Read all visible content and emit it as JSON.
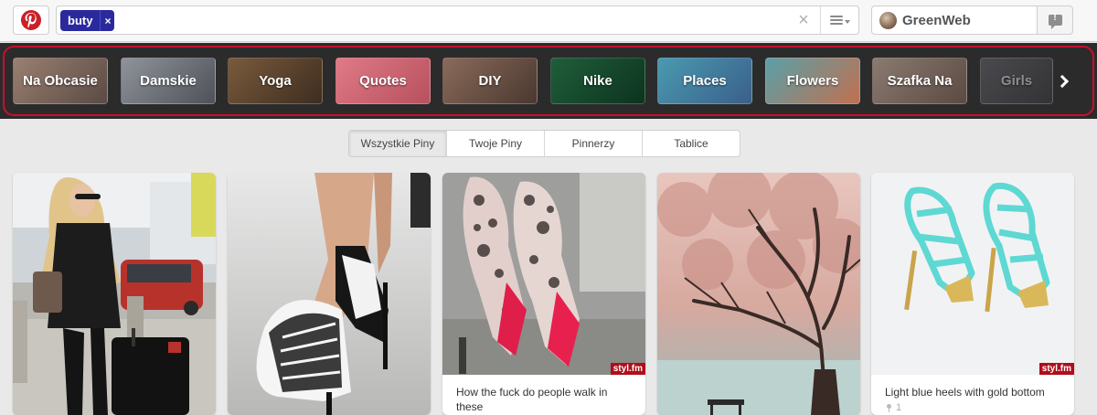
{
  "header": {
    "search_tag": "buty",
    "search_tag_remove": "×",
    "search_clear": "×",
    "user_name": "GreenWeb"
  },
  "related": {
    "chips": [
      {
        "label": "Na Obcasie",
        "colors": [
          "#9a8070",
          "#5a4a45"
        ]
      },
      {
        "label": "Damskie",
        "colors": [
          "#8f939a",
          "#4e5258"
        ]
      },
      {
        "label": "Yoga",
        "colors": [
          "#7a5a3c",
          "#3d2d20"
        ]
      },
      {
        "label": "Quotes",
        "colors": [
          "#e07a86",
          "#b8505e"
        ]
      },
      {
        "label": "DIY",
        "colors": [
          "#8a6a5a",
          "#4a3830"
        ]
      },
      {
        "label": "Nike",
        "colors": [
          "#1f5e3a",
          "#0d3320"
        ]
      },
      {
        "label": "Places",
        "colors": [
          "#4a9ab0",
          "#3a5f8a"
        ]
      },
      {
        "label": "Flowers",
        "colors": [
          "#5aa0a8",
          "#c07050"
        ]
      },
      {
        "label": "Szafka Na",
        "colors": [
          "#8a7a70",
          "#5a4a42"
        ]
      },
      {
        "label": "Girls",
        "colors": [
          "#4a4a4e",
          "#333336"
        ]
      }
    ]
  },
  "filter_tabs": [
    "Wszystkie Piny",
    "Twoje Piny",
    "Pinnerzy",
    "Tablice"
  ],
  "pins": [
    {
      "image": "woman-with-suitcase-photo",
      "description": "",
      "source": "",
      "repins": ""
    },
    {
      "image": "black-white-heels-photo",
      "description": "",
      "source": "",
      "repins": ""
    },
    {
      "image": "lace-red-sole-heels-photo",
      "description": "How the fuck do people walk in these",
      "source": "styl.fm",
      "repins": ""
    },
    {
      "image": "pink-tree-bench-photo",
      "description": "",
      "source": "",
      "repins": ""
    },
    {
      "image": "light-blue-heels-photo",
      "description": "Light blue heels with gold bottom",
      "source": "styl.fm",
      "repins": "1"
    }
  ],
  "colors": {
    "pinterest_red": "#cb2027",
    "tag_blue": "#2a2a9e",
    "strip_bg": "#2b2b2b",
    "strip_frame": "#c8102e",
    "source_badge": "#b00d1b"
  }
}
